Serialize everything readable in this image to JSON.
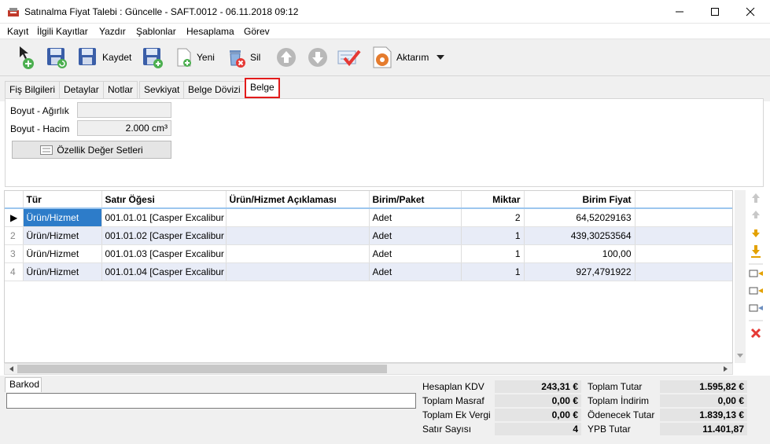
{
  "window": {
    "title": "Satınalma Fiyat Talebi : Güncelle - SAFT.0012 - 06.11.2018 09:12"
  },
  "menu": [
    "Kayıt",
    "İlgili Kayıtlar",
    "Yazdır",
    "Şablonlar",
    "Hesaplama",
    "Görev"
  ],
  "toolbar": {
    "save_label": "Kaydet",
    "new_label": "Yeni",
    "delete_label": "Sil",
    "export_label": "Aktarım"
  },
  "tabs": [
    "Fiş Bilgileri",
    "Detaylar",
    "Notlar",
    "Sevkiyat",
    "Belge Dövizi",
    "Belge"
  ],
  "active_tab": "Belge",
  "form": {
    "weight_label": "Boyut - Ağırlık",
    "weight_value": "",
    "volume_label": "Boyut - Hacim",
    "volume_value": "2.000 cm³",
    "property_sets_button": "Özellik Değer Setleri"
  },
  "grid": {
    "columns": [
      "Tür",
      "Satır Öğesi",
      "Ürün/Hizmet Açıklaması",
      "Birim/Paket",
      "Miktar",
      "Birim Fiyat"
    ],
    "rows": [
      {
        "marker": "▶",
        "type": "Ürün/Hizmet",
        "item": "001.01.01 [Casper Excalibur ...",
        "desc": "",
        "unit": "Adet",
        "qty": "2",
        "price": "64,52029163"
      },
      {
        "marker": "2",
        "type": "Ürün/Hizmet",
        "item": "001.01.02 [Casper Excalibur ...",
        "desc": "",
        "unit": "Adet",
        "qty": "1",
        "price": "439,30253564"
      },
      {
        "marker": "3",
        "type": "Ürün/Hizmet",
        "item": "001.01.03 [Casper Excalibur ...",
        "desc": "",
        "unit": "Adet",
        "qty": "1",
        "price": "100,00"
      },
      {
        "marker": "4",
        "type": "Ürün/Hizmet",
        "item": "001.01.04 [Casper Excalibur ...",
        "desc": "",
        "unit": "Adet",
        "qty": "1",
        "price": "927,4791922"
      }
    ]
  },
  "barcode": {
    "tab_label": "Barkod",
    "value": ""
  },
  "totals": {
    "calc_vat_label": "Hesaplan KDV",
    "calc_vat": "243,31 €",
    "total_expense_label": "Toplam Masraf",
    "total_expense": "0,00 €",
    "extra_tax_label": "Toplam Ek Vergi",
    "extra_tax": "0,00 €",
    "row_count_label": "Satır Sayısı",
    "row_count": "4",
    "total_amount_label": "Toplam Tutar",
    "total_amount": "1.595,82 €",
    "total_discount_label": "Toplam İndirim",
    "total_discount": "0,00 €",
    "payable_label": "Ödenecek Tutar",
    "payable": "1.839,13 €",
    "ypb_label": "YPB Tutar",
    "ypb": "11.401,87"
  },
  "colors": {
    "active_tab_border": "#e21b1b",
    "selection": "#2d7cc9",
    "alt_row": "#e8ecf7"
  }
}
